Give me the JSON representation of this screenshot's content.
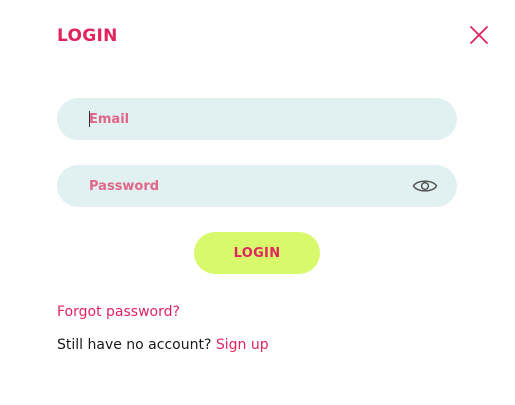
{
  "header": {
    "title": "LOGIN",
    "close_icon": "close-icon"
  },
  "form": {
    "email_placeholder": "Email",
    "email_value": "",
    "password_placeholder": "Password",
    "password_value": "",
    "eye_icon": "eye-icon",
    "submit_label": "LOGIN"
  },
  "links": {
    "forgot_password": "Forgot password?",
    "no_account_text": "Still have no account?",
    "sign_up": "Sign up"
  },
  "colors": {
    "accent": "#e0245e",
    "field_bg": "#e1f0f0",
    "button_bg": "#d9f96c",
    "text": "#1a1a1a"
  }
}
